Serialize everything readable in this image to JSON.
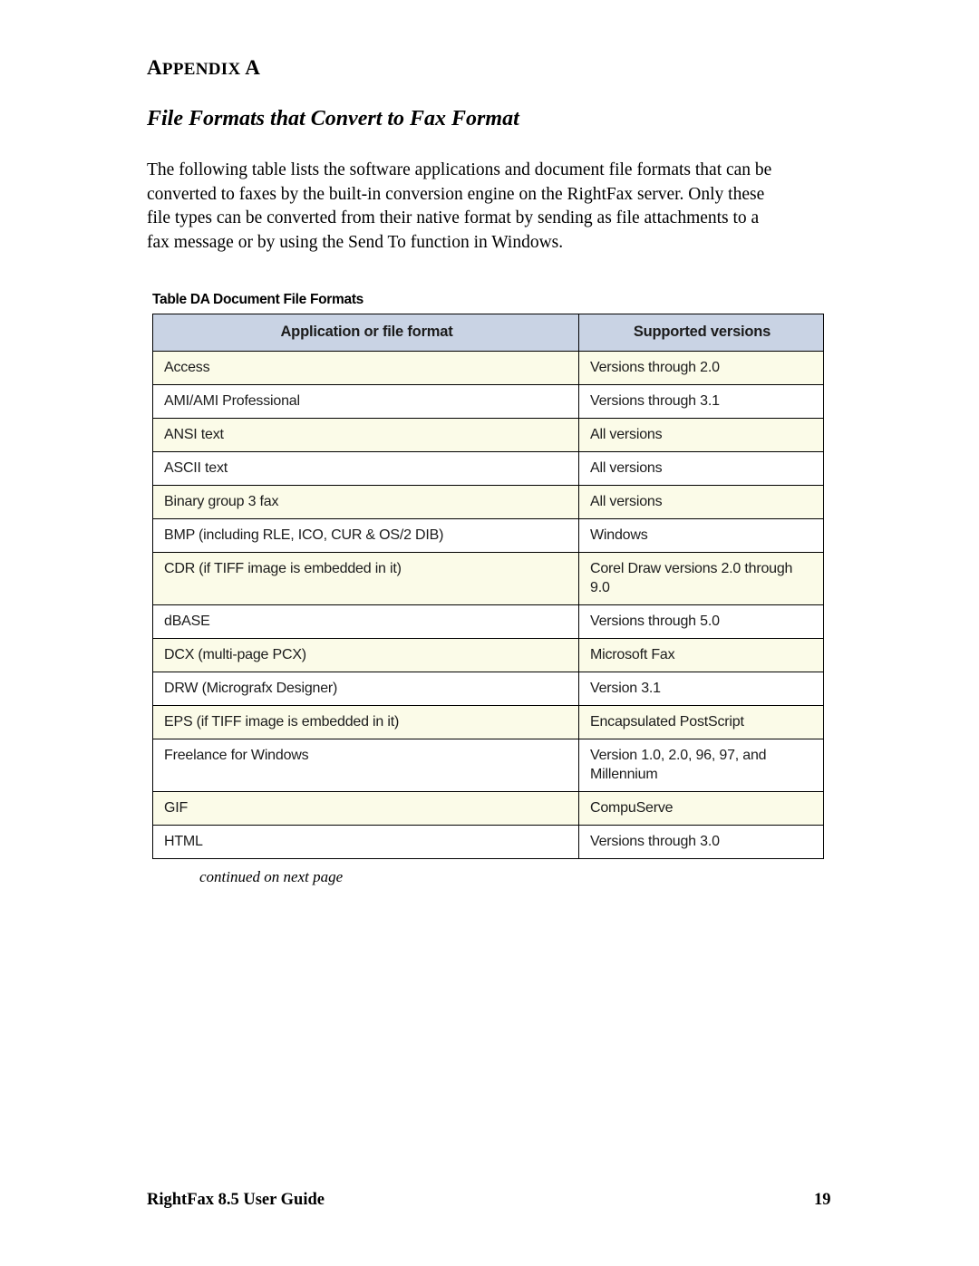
{
  "appendix": {
    "label": "APPENDIX A",
    "subtitle": "File Formats that Convert to Fax Format",
    "intro": "The following table lists the software applications and document file formats that can be converted to faxes by the built-in conversion engine on the RightFax server. Only these file types can be converted from their native format by sending as file attachments to a fax message or by using the Send To function in Windows."
  },
  "table": {
    "caption": "Table DA Document File Formats",
    "headers": [
      "Application or file format",
      "Supported versions"
    ],
    "rows": [
      {
        "format": "Access",
        "versions": "Versions through 2.0"
      },
      {
        "format": "AMI/AMI Professional",
        "versions": "Versions through 3.1"
      },
      {
        "format": "ANSI text",
        "versions": "All versions"
      },
      {
        "format": "ASCII text",
        "versions": "All versions"
      },
      {
        "format": "Binary group 3 fax",
        "versions": "All versions"
      },
      {
        "format": "BMP (including RLE, ICO, CUR & OS/2 DIB)",
        "versions": "Windows"
      },
      {
        "format": "CDR (if TIFF image is embedded in it)",
        "versions": "Corel Draw versions 2.0 through 9.0"
      },
      {
        "format": "dBASE",
        "versions": "Versions through 5.0"
      },
      {
        "format": "DCX (multi-page PCX)",
        "versions": "Microsoft Fax"
      },
      {
        "format": "DRW (Micrografx Designer)",
        "versions": "Version 3.1"
      },
      {
        "format": "EPS (if TIFF image is embedded in it)",
        "versions": "Encapsulated PostScript"
      },
      {
        "format": "Freelance for Windows",
        "versions": "Version 1.0, 2.0, 96, 97, and Millennium"
      },
      {
        "format": "GIF",
        "versions": "CompuServe"
      },
      {
        "format": "HTML",
        "versions": "Versions through 3.0"
      }
    ],
    "continued_note": "continued on next page"
  },
  "footer": {
    "document_title": "RightFax 8.5 User Guide",
    "page_number": "19"
  }
}
